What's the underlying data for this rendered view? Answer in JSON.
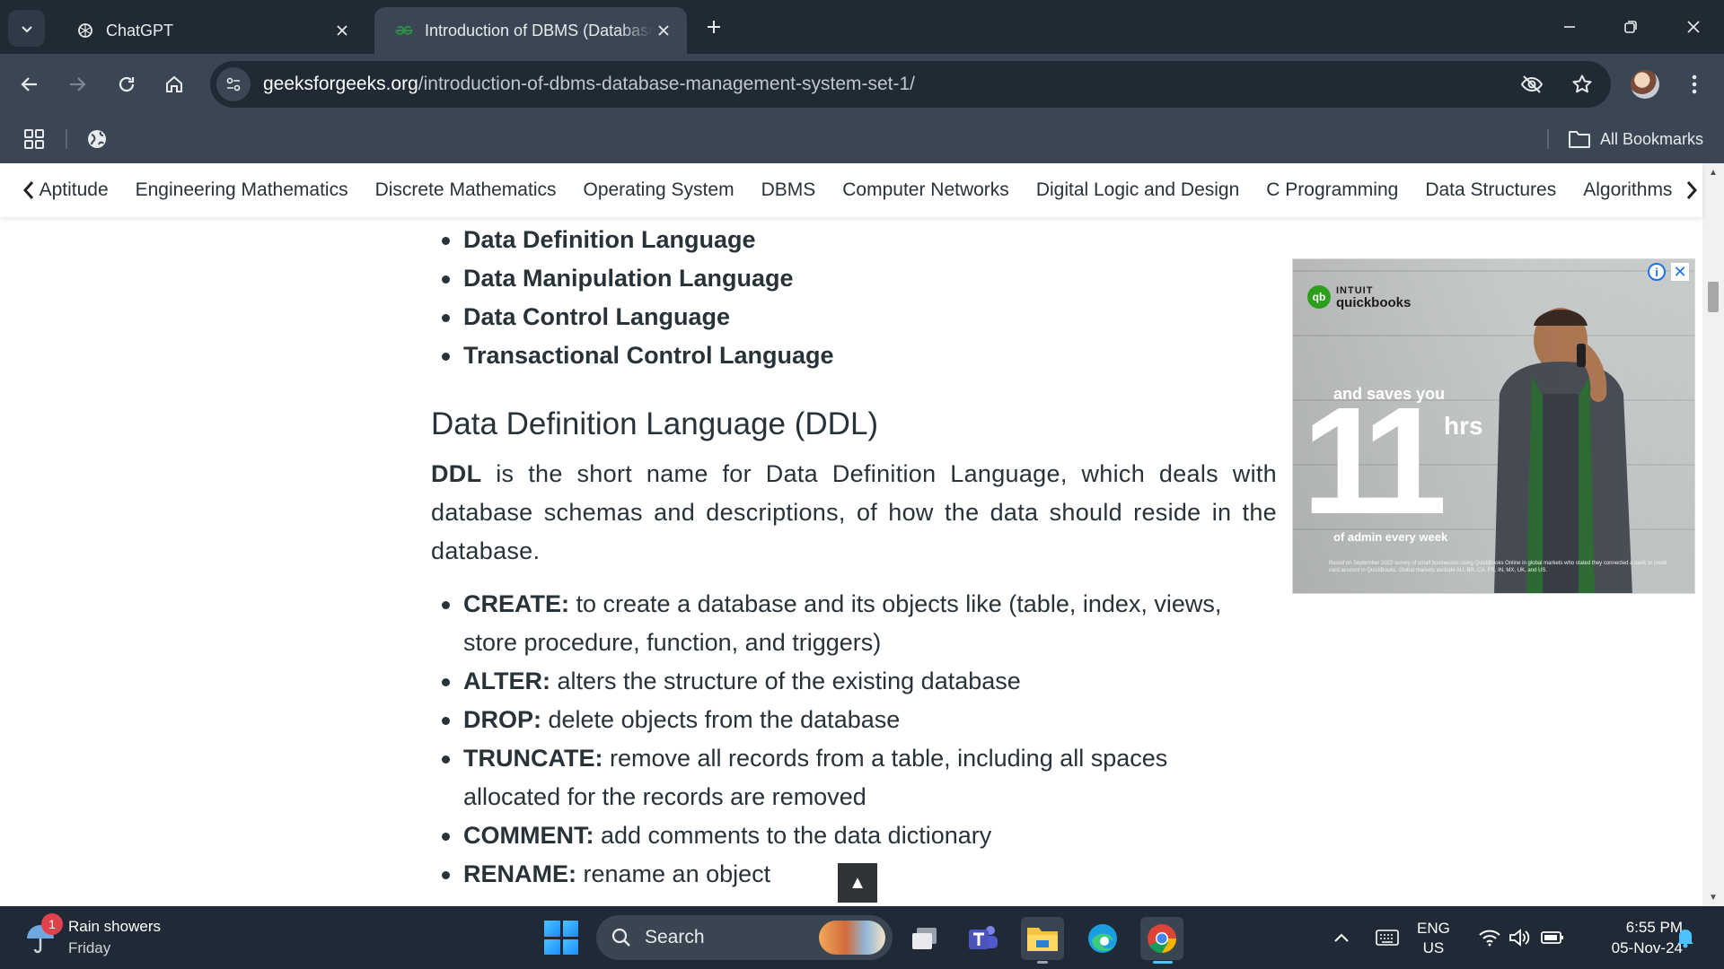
{
  "browser": {
    "tabs": [
      {
        "title": "ChatGPT",
        "active": false
      },
      {
        "title": "Introduction of DBMS (Database Management System)",
        "active": true
      }
    ],
    "url_host": "geeksforgeeks.org",
    "url_path": "/introduction-of-dbms-database-management-system-set-1/",
    "all_bookmarks_label": "All Bookmarks"
  },
  "topnav": {
    "items": [
      "Aptitude",
      "Engineering Mathematics",
      "Discrete Mathematics",
      "Operating System",
      "DBMS",
      "Computer Networks",
      "Digital Logic and Design",
      "C Programming",
      "Data Structures",
      "Algorithms"
    ]
  },
  "article": {
    "languages": [
      "Data Definition Language",
      "Data Manipulation Language",
      "Data Control Language",
      "Transactional Control Language"
    ],
    "heading": "Data Definition Language (DDL)",
    "para_bold": "DDL",
    "para_rest": " is the short name for Data Definition Language, which deals with database schemas and descriptions, of how the data should reside in the database.",
    "commands": [
      {
        "name": "CREATE:",
        "desc": " to create a database and its objects like (table, index, views, store procedure, function, and triggers)"
      },
      {
        "name": "ALTER:",
        "desc": " alters the structure of the existing database"
      },
      {
        "name": "DROP:",
        "desc": " delete objects from the database"
      },
      {
        "name": "TRUNCATE:",
        "desc": " remove all records from a table, including all spaces allocated for the records are removed"
      },
      {
        "name": "COMMENT:",
        "desc": " add comments to the data dictionary"
      },
      {
        "name": "RENAME:",
        "desc": " rename an object"
      }
    ],
    "scroll_top_glyph": "▲"
  },
  "ad": {
    "brand_small": "INTUIT",
    "brand": "quickbooks",
    "saves": "and saves you",
    "number": "11",
    "unit": "hrs",
    "tagline": "of admin every week",
    "fine_print": "Based on September 2022 survey of small businesses using QuickBooks Online in global markets who stated they connected a bank or credit card account in QuickBooks. Global markets exclude AU, BR, CA, FR, IN, MX, UK, and US.",
    "info_glyph": "i",
    "close_glyph": "✕"
  },
  "taskbar": {
    "weather_title": "Rain showers",
    "weather_sub": "Friday",
    "weather_badge": "1",
    "search_label": "Search",
    "lang_top": "ENG",
    "lang_bottom": "US",
    "time": "6:55 PM",
    "date": "05-Nov-24"
  },
  "colors": {
    "chrome_dark": "#202a35",
    "chrome_toolbar": "#3a4654",
    "text": "#273239",
    "taskbar": "#1f2a36",
    "accent": "#2f8d46"
  }
}
